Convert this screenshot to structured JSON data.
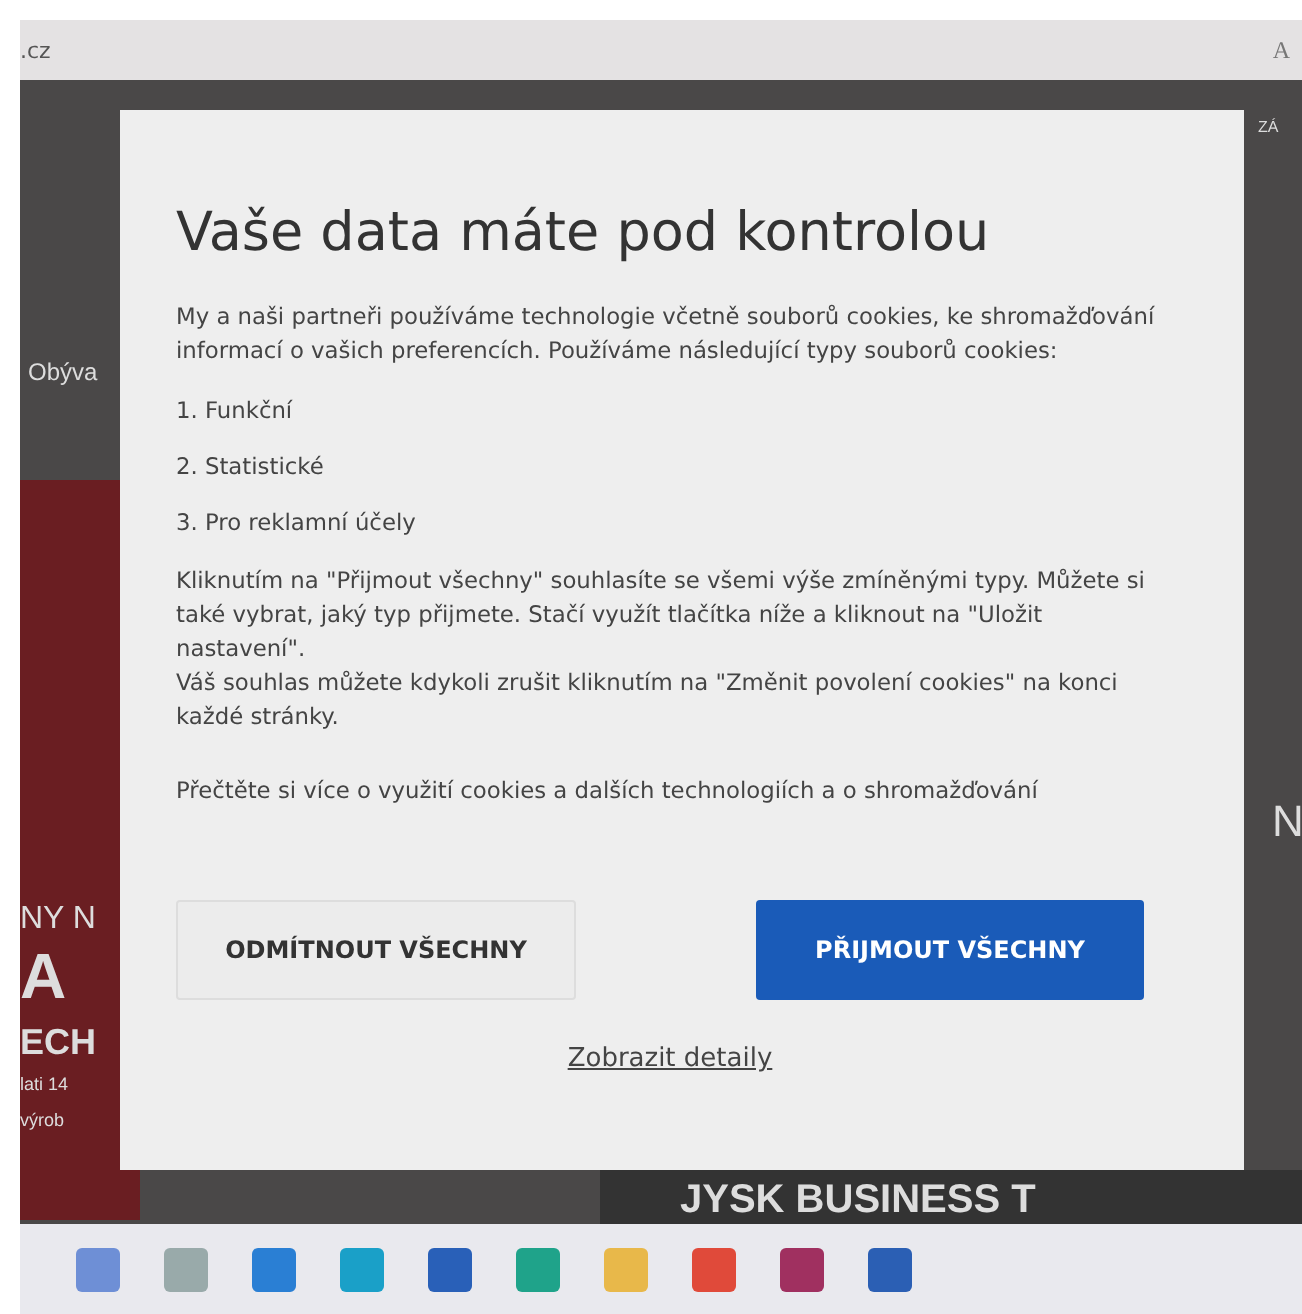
{
  "browser": {
    "address": ".cz",
    "reader_button": "A"
  },
  "background_page": {
    "top_right": "ZÁ",
    "left_menu": "Obýva",
    "left_banner": [
      "NY N",
      "A",
      "ECH",
      "lati 14",
      "výrob"
    ],
    "right_banner": "N",
    "bottom_banner": "JYSK BUSINESS T"
  },
  "dialog": {
    "title": "Vaše data máte pod kontrolou",
    "intro": "My a naši partneři používáme technologie včetně souborů cookies, ke shromažďování informací o vašich preferencích. Používáme následující typy souborů cookies:",
    "types": [
      "1. Funkční",
      "2. Statistické",
      "3. Pro reklamní účely"
    ],
    "consent_text": "Kliknutím na \"Přijmout všechny\" souhlasíte se všemi výše zmíněnými typy. Můžete si také vybrat, jaký typ přijmete. Stačí využít tlačítka níže a kliknout na \"Uložit nastavení\".",
    "revoke_text": "Váš souhlas můžete kdykoli zrušit kliknutím na \"Změnit povolení cookies\" na konci každé stránky.",
    "more_text": "Přečtěte si více o využití cookies a dalších technologiích a o shromažďování",
    "buttons": [
      {
        "label": "ODMÍTNOUT VŠECHNY",
        "kind": "secondary"
      },
      {
        "label": "PŘIJMOUT VŠECHNY",
        "kind": "primary"
      }
    ],
    "details_link": "Zobrazit detaily"
  }
}
